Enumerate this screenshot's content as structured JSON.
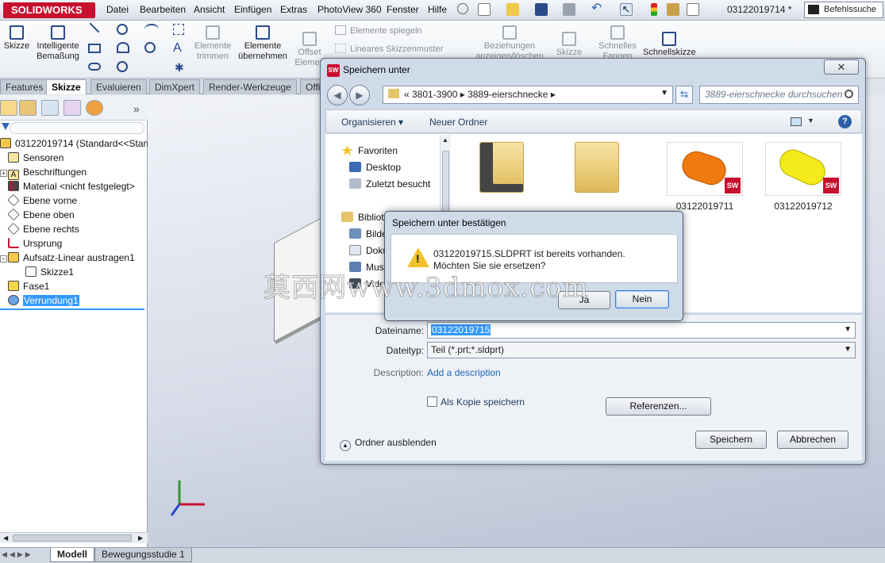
{
  "app": {
    "logo": "SOLIDWORKS",
    "doc_name": "03122019714 *",
    "command_search": "Befehlssuche"
  },
  "menu": [
    "Datei",
    "Bearbeiten",
    "Ansicht",
    "Einfügen",
    "Extras",
    "PhotoView 360",
    "Fenster",
    "Hilfe"
  ],
  "ribbon": {
    "sketch": "Skizze",
    "smart_dim_1": "Intelligente",
    "smart_dim_2": "Bemaßung",
    "trim_1": "Elemente",
    "trim_2": "trimmen",
    "convert_1": "Elemente",
    "convert_2": "übernehmen",
    "offset_1": "Offset",
    "offset_2": "Elemen",
    "mirror": "Elemente spiegeln",
    "linear_pattern": "Lineares Skizzenmuster",
    "relations_1": "Beziehungen",
    "relations_2": "anzeigen/löschen",
    "repair": "Skizze",
    "quick_snaps_1": "Schnelles",
    "quick_snaps_2": "Fangen",
    "rapid_sketch": "Schnellskizze"
  },
  "tabs": [
    "Features",
    "Skizze",
    "Evaluieren",
    "DimXpert",
    "Render-Werkzeuge",
    "Offi"
  ],
  "tree": {
    "root": "03122019714  (Standard<<Stand",
    "items": [
      "Sensoren",
      "Beschriftungen",
      "Material <nicht festgelegt>",
      "Ebene vorne",
      "Ebene oben",
      "Ebene rechts",
      "Ursprung",
      "Aufsatz-Linear austragen1",
      "Skizze1",
      "Fase1",
      "Verrundung1"
    ]
  },
  "bottom_tabs": [
    "Modell",
    "Bewegungsstudie 1"
  ],
  "save_dialog": {
    "title": "Speichern unter",
    "breadcrumb": "«  3801-3900  ▸  3889-eierschnecke  ▸",
    "search_placeholder": "3889-eierschnecke durchsuchen",
    "organize": "Organisieren ▾",
    "new_folder": "Neuer Ordner",
    "nav": [
      "Favoriten",
      "Desktop",
      "Zuletzt besucht",
      "Bibliot",
      "Bilde",
      "Doku",
      "Musi",
      "Vide"
    ],
    "files": [
      "03122019711",
      "03122019712"
    ],
    "filename_label": "Dateiname:",
    "filename_value": "03122019715",
    "filetype_label": "Dateityp:",
    "filetype_value": "Teil (*.prt;*.sldprt)",
    "description_label": "Description:",
    "description_link": "Add a description",
    "copy_label": "Als Kopie speichern",
    "references": "Referenzen...",
    "hide_folders": "Ordner ausblenden",
    "save": "Speichern",
    "cancel": "Abbrechen"
  },
  "confirm_dialog": {
    "title": "Speichern unter bestätigen",
    "msg1": "03122019715.SLDPRT ist bereits vorhanden.",
    "msg2": "Möchten Sie sie ersetzen?",
    "yes": "Ja",
    "no": "Nein"
  },
  "watermark": "莫西网www.3dmox.com",
  "colors": {
    "brand_red": "#c8102e",
    "selection_blue": "#3399ff",
    "orange_part": "#f07a10",
    "yellow_part": "#f2ea1a"
  }
}
